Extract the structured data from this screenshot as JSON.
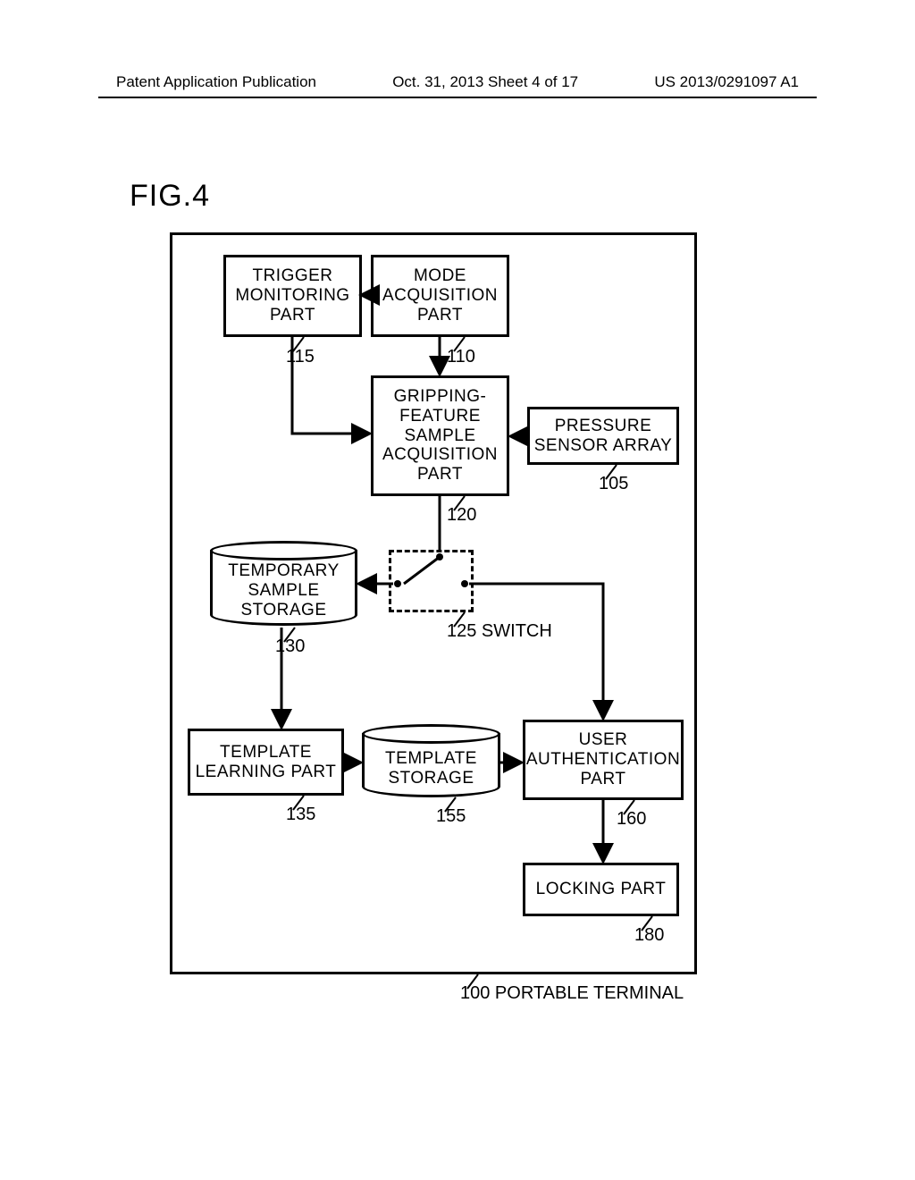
{
  "header": {
    "left": "Patent Application Publication",
    "center": "Oct. 31, 2013   Sheet 4 of 17",
    "right": "US 2013/0291097 A1"
  },
  "figure_label": "FIG.4",
  "blocks": {
    "trigger": "TRIGGER\nMONITORING\nPART",
    "mode": "MODE\nACQUISITION\nPART",
    "gripping": "GRIPPING-\nFEATURE\nSAMPLE\nACQUISITION\nPART",
    "pressure": "PRESSURE\nSENSOR ARRAY",
    "tempstore": "TEMPORARY\nSAMPLE\nSTORAGE",
    "tlearn": "TEMPLATE\nLEARNING PART",
    "tstore": "TEMPLATE\nSTORAGE",
    "userauth": "USER\nAUTHENTICATION\nPART",
    "locking": "LOCKING PART"
  },
  "refs": {
    "trigger": "115",
    "mode": "110",
    "gripping": "120",
    "pressure": "105",
    "switch": "125 SWITCH",
    "tempstore": "130",
    "tlearn": "135",
    "tstore": "155",
    "userauth": "160",
    "locking": "180",
    "container": "100 PORTABLE TERMINAL"
  }
}
